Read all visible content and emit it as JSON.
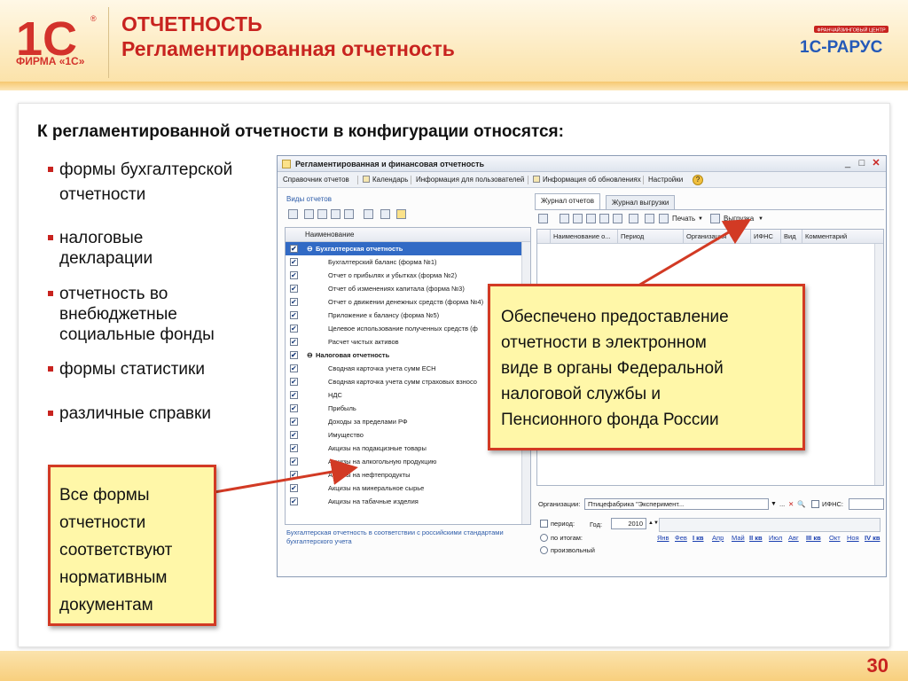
{
  "header": {
    "title": "ОТЧЕТНОСТЬ",
    "subtitle": "Регламентированная отчетность",
    "logo_text": "ФИРМА «1С»",
    "logo_mark": "1С",
    "rarus_text": "1С-РАРУС",
    "rarus_badge": "ФРАНЧАЙЗИНГОВЫЙ ЦЕНТР"
  },
  "intro": "К регламентированной отчетности в конфигурации относятся:",
  "bullets": [
    {
      "line1": "формы бухгалтерской",
      "line2": "отчетности"
    },
    {
      "line1": "налоговые",
      "line2": "декларации"
    },
    {
      "line1": "отчетность во",
      "line2": "внебюджетные",
      "line3": "социальные фонды"
    },
    {
      "line1": "формы статистики"
    },
    {
      "line1": "различные справки"
    }
  ],
  "window": {
    "title": "Регламентированная и финансовая отчетность",
    "menu": [
      "Справочник отчетов",
      "Календарь",
      "Информация для пользователей",
      "Информация об обновлениях",
      "Настройки"
    ],
    "left": {
      "header": "Виды отчетов",
      "column": "Наименование",
      "rows": [
        {
          "label": "Бухгалтерская отчетность",
          "type": "group-selected"
        },
        {
          "label": "Бухгалтерский баланс (форма №1)"
        },
        {
          "label": "Отчет о прибылях и убытках (форма №2)"
        },
        {
          "label": "Отчет об изменениях капитала (форма №3)"
        },
        {
          "label": "Отчет о движении денежных средств (форма №4)"
        },
        {
          "label": "Приложение к балансу (форма №5)"
        },
        {
          "label": "Целевое использование полученных средств (ф"
        },
        {
          "label": "Расчет чистых активов"
        },
        {
          "label": "Налоговая отчетность",
          "type": "group"
        },
        {
          "label": "Сводная карточка учета сумм ЕСН"
        },
        {
          "label": "Сводная карточка учета сумм страховых взносо"
        },
        {
          "label": "НДС"
        },
        {
          "label": "Прибыль"
        },
        {
          "label": "Доходы за пределами РФ"
        },
        {
          "label": "Имущество"
        },
        {
          "label": "Акцизы на подакцизные товары"
        },
        {
          "label": "Акцизы на алкогольную продукцию"
        },
        {
          "label": "Акцизы на нефтепродукты"
        },
        {
          "label": "Акцизы на минеральное сырье"
        },
        {
          "label": "Акцизы на табачные изделия"
        }
      ],
      "description": "Бухгалтерская отчетность в соответствии с российскими стандартами бухгалтерского учета"
    },
    "right": {
      "tab1": "Журнал отчетов",
      "tab2": "Журнал выгрузки",
      "print": "Печать",
      "export": "Выгрузка",
      "columns": [
        "Наименование о...",
        "Период",
        "Организация",
        "ИФНС",
        "Вид",
        "Комментарий"
      ],
      "org_label": "Организации:",
      "org_value": "Птицефабрика \"Эксперимент...",
      "ifns_label": "ИФНС:",
      "period_label": "период:",
      "year_label": "Год:",
      "year_value": "2010",
      "by_totals": "по итогам:",
      "arbitrary": "произвольный",
      "months": [
        "Янв",
        "Фев",
        "I кв",
        "Апр",
        "Май",
        "II кв",
        "Июл",
        "Авг",
        "III кв",
        "Окт",
        "Ноя",
        "IV кв"
      ]
    }
  },
  "callout_right": [
    "Обеспечено предоставление",
    "отчетности в электронном",
    "виде в органы Федеральной",
    "налоговой службы и",
    "Пенсионного фонда России"
  ],
  "callout_left": [
    "Все формы",
    "отчетности",
    "соответствуют",
    "нормативным",
    "документам"
  ],
  "page_number": "30",
  "colors": {
    "brand_red": "#c8231f",
    "callout_fill": "#fff7a8",
    "selection_blue": "#316ac5"
  }
}
